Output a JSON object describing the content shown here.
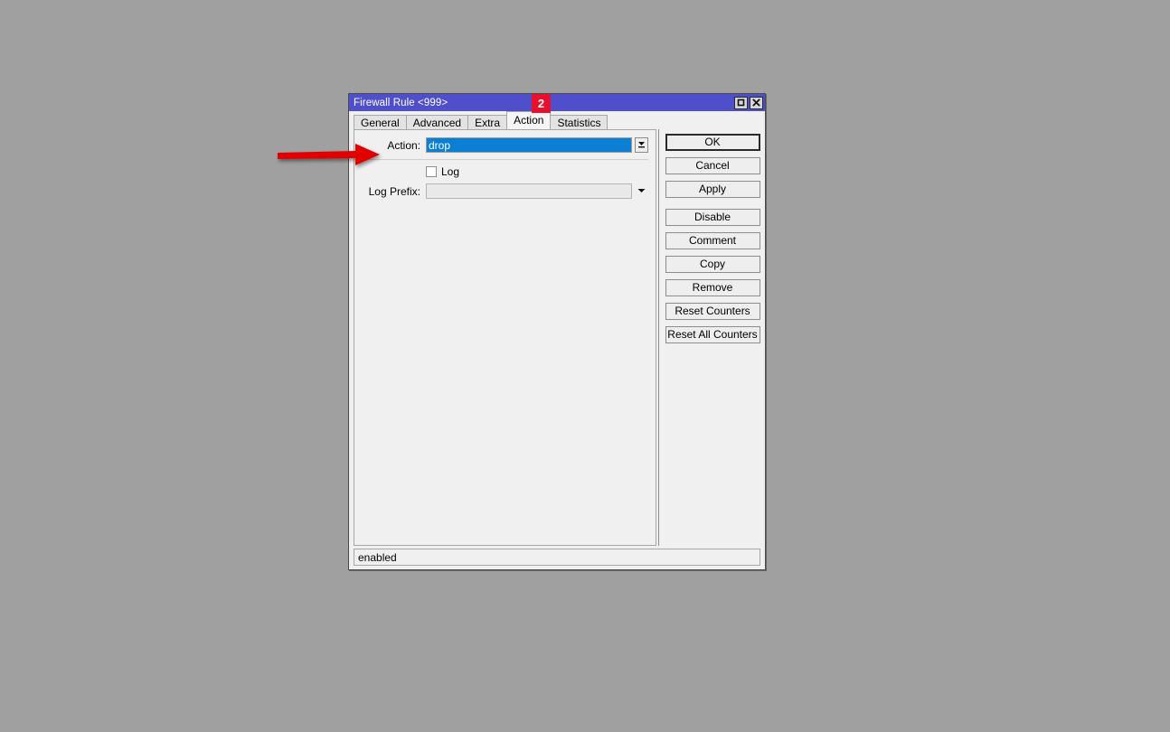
{
  "desktop": {
    "background_color": "#a0a0a0"
  },
  "window": {
    "title": "Firewall Rule <999>",
    "titlebar_color": "#4f4fcc",
    "controls": [
      {
        "name": "maximize",
        "icon": "maximize-icon"
      },
      {
        "name": "close",
        "icon": "close-icon"
      }
    ]
  },
  "tabs": [
    {
      "label": "General",
      "selected": false
    },
    {
      "label": "Advanced",
      "selected": false
    },
    {
      "label": "Extra",
      "selected": false
    },
    {
      "label": "Action",
      "selected": true
    },
    {
      "label": "Statistics",
      "selected": false
    }
  ],
  "form": {
    "action": {
      "label": "Action:",
      "value": "drop",
      "placeholder": "",
      "selected": true,
      "selection_color": "#0b7fd4",
      "dropdown_icon": "dropdown-arrow-icon"
    },
    "log": {
      "label": "Log",
      "checked": false
    },
    "log_prefix": {
      "label": "Log Prefix:",
      "value": "",
      "placeholder": "",
      "disabled": true,
      "dropdown_icon": "chevron-down-icon"
    }
  },
  "buttons": [
    {
      "label": "OK",
      "focused": true
    },
    {
      "label": "Cancel",
      "focused": false
    },
    {
      "label": "Apply",
      "focused": false
    },
    {
      "label": "Disable",
      "focused": false
    },
    {
      "label": "Comment",
      "focused": false
    },
    {
      "label": "Copy",
      "focused": false
    },
    {
      "label": "Remove",
      "focused": false
    },
    {
      "label": "Reset Counters",
      "focused": false
    },
    {
      "label": "Reset All Counters",
      "focused": false
    }
  ],
  "statusbar": {
    "text": "enabled"
  },
  "annotations": {
    "badge": {
      "text": "2",
      "color": "#e8112d"
    },
    "arrow": {
      "color": "#e00000",
      "direction": "right",
      "points_to": "Action:"
    }
  }
}
